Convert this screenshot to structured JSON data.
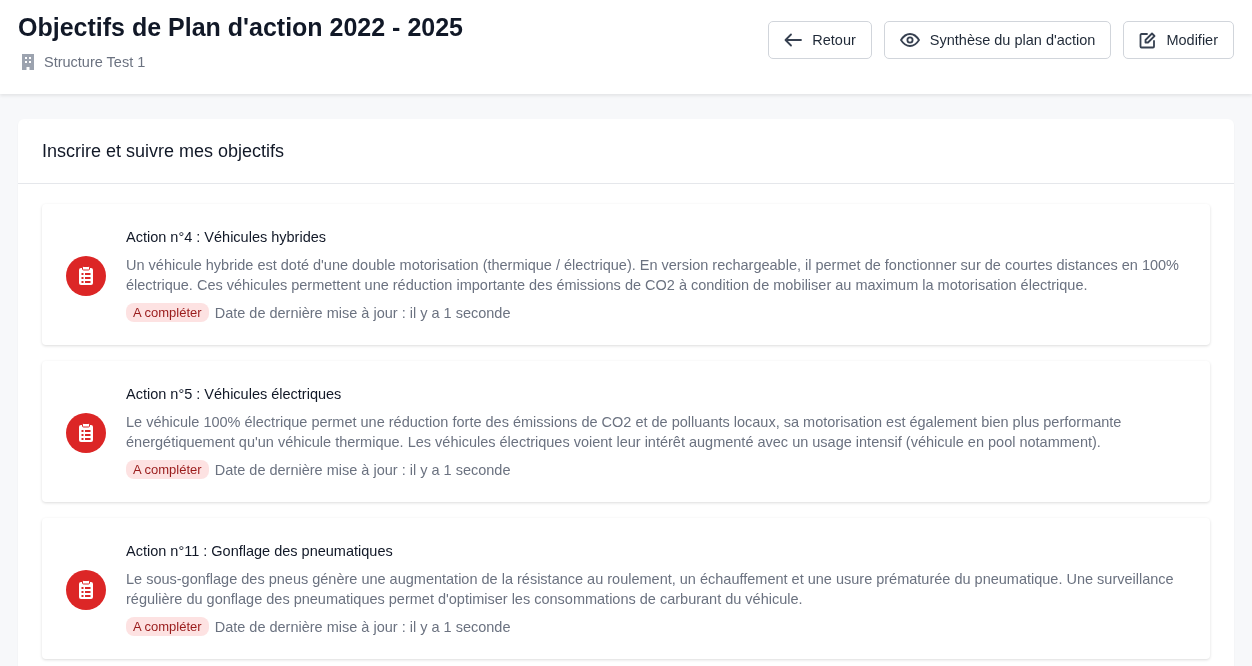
{
  "header": {
    "title": "Objectifs de Plan d'action 2022 - 2025",
    "structure": "Structure Test 1",
    "buttons": [
      {
        "kind": "back",
        "label": "Retour"
      },
      {
        "kind": "view",
        "label": "Synthèse du plan d'action"
      },
      {
        "kind": "edit",
        "label": "Modifier"
      }
    ]
  },
  "panel": {
    "title": "Inscrire et suivre mes objectifs",
    "actions": [
      {
        "title": "Action n°4 : Véhicules hybrides",
        "description": "Un véhicule hybride est doté d'une double motorisation (thermique / électrique). En version rechargeable, il permet de fonctionner sur de courtes distances en 100% électrique. Ces véhicules permettent une réduction importante des émissions de CO2 à condition de mobiliser au maximum la motorisation électrique.",
        "status": "A compléter",
        "updated": "Date de dernière mise à jour : il y a 1 seconde"
      },
      {
        "title": "Action n°5 : Véhicules électriques",
        "description": "Le véhicule 100% électrique permet une réduction forte des émissions de CO2 et de polluants locaux, sa motorisation est également bien plus performante énergétiquement qu'un véhicule thermique. Les véhicules électriques voient leur intérêt augmenté avec un usage intensif (véhicule en pool notamment).",
        "status": "A compléter",
        "updated": "Date de dernière mise à jour : il y a 1 seconde"
      },
      {
        "title": "Action n°11 : Gonflage des pneumatiques",
        "description": "Le sous-gonflage des pneus génère une augmentation de la résistance au roulement, un échauffement et une usure prématurée du pneumatique. Une surveillance régulière du gonflage des pneumatiques permet d'optimiser les consommations de carburant du véhicule.",
        "status": "A compléter",
        "updated": "Date de dernière mise à jour : il y a 1 seconde"
      }
    ]
  }
}
